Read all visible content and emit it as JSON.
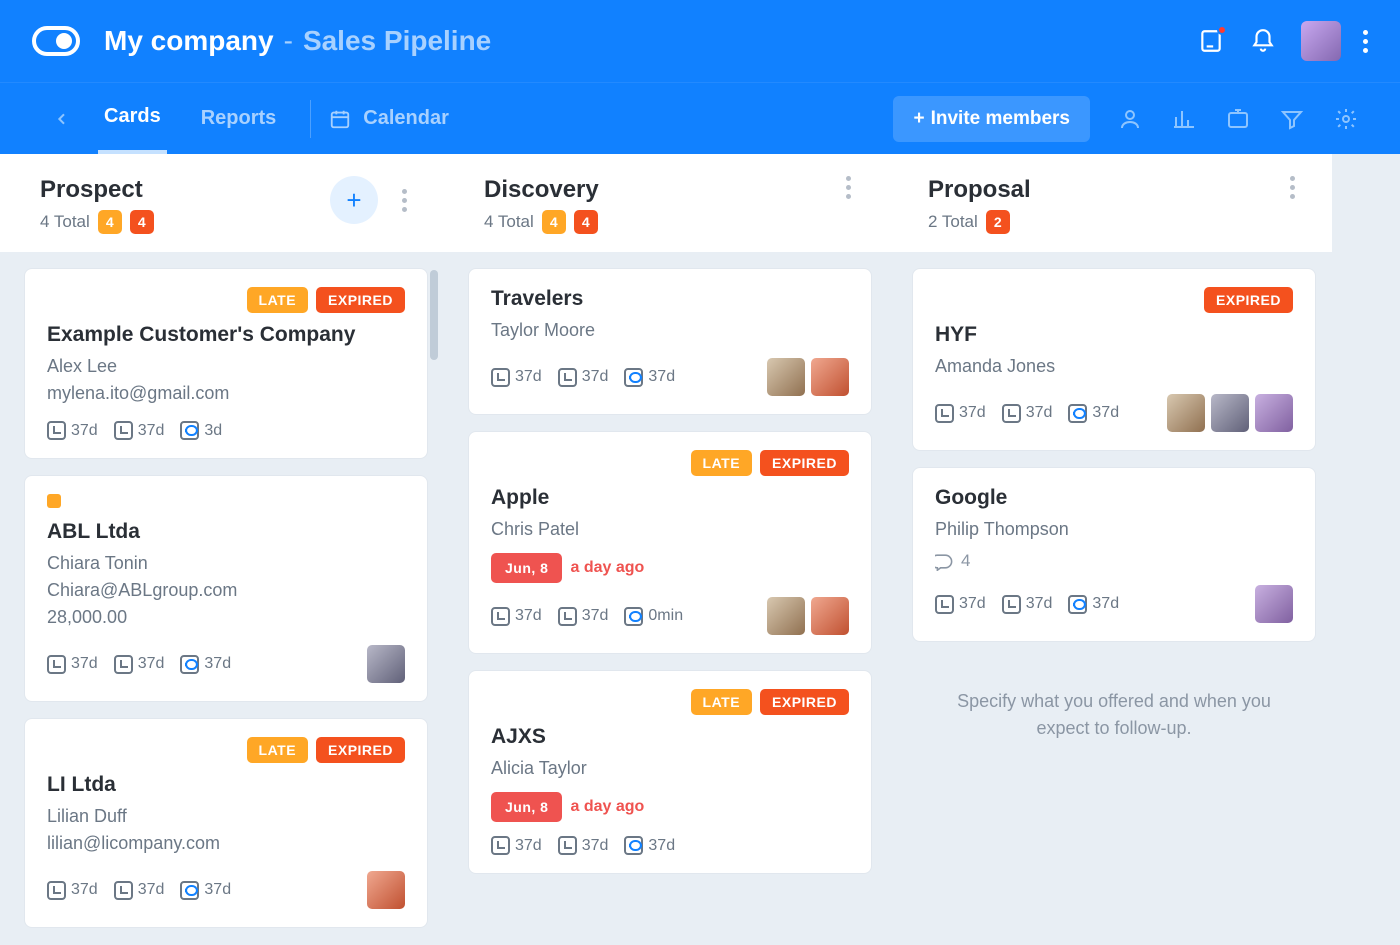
{
  "header": {
    "company": "My company",
    "subtitle": "Sales Pipeline"
  },
  "nav": {
    "tabs": [
      "Cards",
      "Reports"
    ],
    "calendar": "Calendar",
    "invite": "Invite members"
  },
  "columns": [
    {
      "title": "Prospect",
      "total_label": "4 Total",
      "badges": [
        {
          "count": "4",
          "color": "orange"
        },
        {
          "count": "4",
          "color": "red"
        }
      ],
      "show_add": true,
      "cards": [
        {
          "badges": [
            "LATE",
            "EXPIRED"
          ],
          "title": "Example Customer's Company",
          "lines": [
            "Alex Lee",
            "mylena.ito@gmail.com"
          ],
          "times": [
            {
              "v": "37d",
              "c": "orange"
            },
            {
              "v": "37d",
              "c": "green"
            },
            {
              "v": "3d",
              "c": "blue"
            }
          ],
          "avatars": []
        },
        {
          "orange_dot": true,
          "title": "ABL Ltda",
          "lines": [
            "Chiara Tonin",
            "Chiara@ABLgroup.com",
            "28,000.00"
          ],
          "times": [
            {
              "v": "37d",
              "c": "orange"
            },
            {
              "v": "37d",
              "c": "green"
            },
            {
              "v": "37d",
              "c": "blue"
            }
          ],
          "avatars": [
            "a3"
          ]
        },
        {
          "badges": [
            "LATE",
            "EXPIRED"
          ],
          "title": "LI Ltda",
          "lines": [
            "Lilian Duff",
            "lilian@licompany.com"
          ],
          "times": [
            {
              "v": "37d",
              "c": "orange"
            },
            {
              "v": "37d",
              "c": "green"
            },
            {
              "v": "37d",
              "c": "blue"
            }
          ],
          "avatars": [
            "a2"
          ]
        }
      ]
    },
    {
      "title": "Discovery",
      "total_label": "4 Total",
      "badges": [
        {
          "count": "4",
          "color": "orange"
        },
        {
          "count": "4",
          "color": "red"
        }
      ],
      "cards": [
        {
          "title": "Travelers",
          "lines": [
            "Taylor Moore"
          ],
          "times": [
            {
              "v": "37d",
              "c": "orange"
            },
            {
              "v": "37d",
              "c": "green"
            },
            {
              "v": "37d",
              "c": "blue"
            }
          ],
          "avatars": [
            "a1",
            "a2"
          ]
        },
        {
          "badges": [
            "LATE",
            "EXPIRED"
          ],
          "title": "Apple",
          "lines": [
            "Chris Patel"
          ],
          "date_chip": "Jun, 8",
          "relative": "a day ago",
          "times": [
            {
              "v": "37d",
              "c": "orange"
            },
            {
              "v": "37d",
              "c": "green"
            },
            {
              "v": "0min",
              "c": "blue"
            }
          ],
          "avatars": [
            "a1",
            "a2"
          ]
        },
        {
          "badges": [
            "LATE",
            "EXPIRED"
          ],
          "title": "AJXS",
          "lines": [
            "Alicia Taylor"
          ],
          "date_chip": "Jun, 8",
          "relative": "a day ago",
          "times": [
            {
              "v": "37d",
              "c": "orange"
            },
            {
              "v": "37d",
              "c": "green"
            },
            {
              "v": "37d",
              "c": "blue"
            }
          ],
          "avatars": []
        }
      ]
    },
    {
      "title": "Proposal",
      "total_label": "2 Total",
      "badges": [
        {
          "count": "2",
          "color": "red"
        }
      ],
      "cards": [
        {
          "badges": [
            "EXPIRED"
          ],
          "title": "HYF",
          "lines": [
            "Amanda Jones"
          ],
          "times": [
            {
              "v": "37d",
              "c": "orange"
            },
            {
              "v": "37d",
              "c": "green"
            },
            {
              "v": "37d",
              "c": "blue"
            }
          ],
          "avatars": [
            "a1",
            "a3",
            "a4"
          ]
        },
        {
          "title": "Google",
          "lines": [
            "Philip Thompson"
          ],
          "comments": "4",
          "times": [
            {
              "v": "37d",
              "c": "orange"
            },
            {
              "v": "37d",
              "c": "green"
            },
            {
              "v": "37d",
              "c": "blue"
            }
          ],
          "avatars": [
            "a4"
          ]
        }
      ],
      "empty_hint": "Specify what you offered and when you expect to follow-up."
    }
  ]
}
